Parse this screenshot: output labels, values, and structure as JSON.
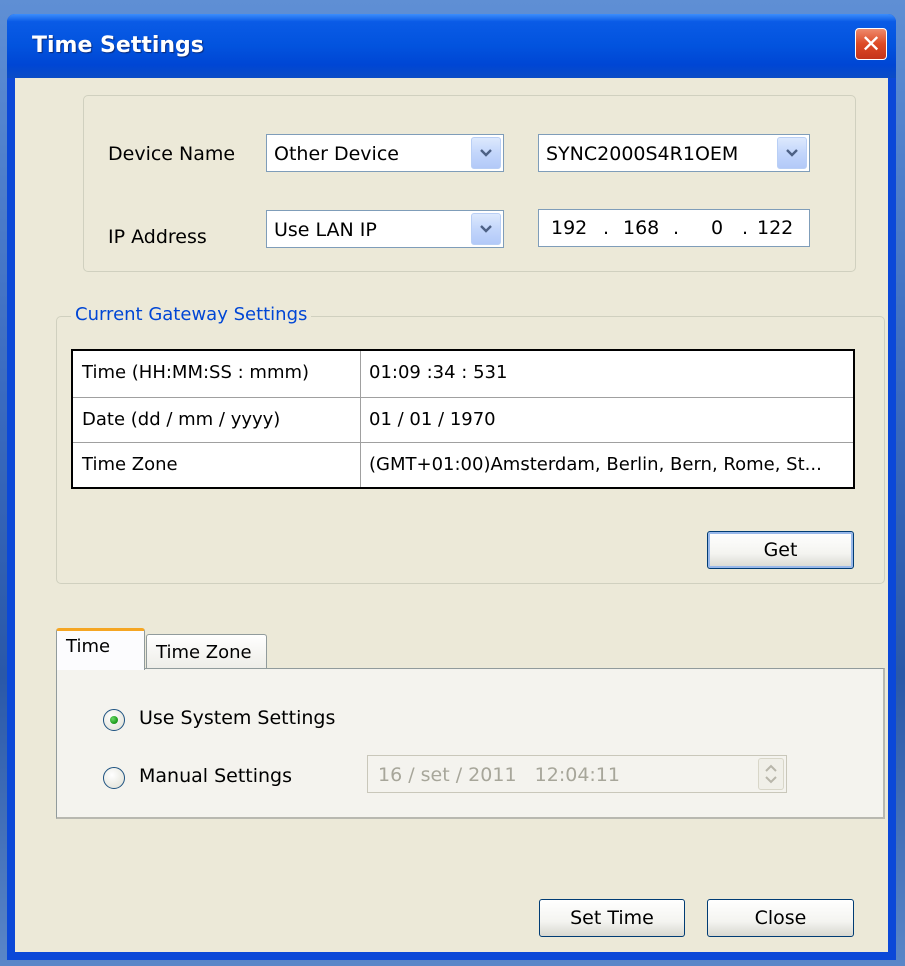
{
  "window": {
    "title": "Time Settings",
    "close_label": "✕"
  },
  "device": {
    "name_label": "Device Name",
    "name_value": "Other Device",
    "model_value": "SYNC2000S4R1OEM",
    "ip_label": "IP Address",
    "ip_mode_value": "Use LAN IP",
    "ip_octets": [
      "192",
      "168",
      "0",
      "122"
    ],
    "ip_separators": [
      ".",
      ".",
      "."
    ]
  },
  "gateway": {
    "legend": "Current Gateway Settings",
    "rows": [
      {
        "label": "Time (HH:MM:SS : mmm)",
        "value": "01:09 :34 : 531"
      },
      {
        "label": "Date (dd / mm / yyyy)",
        "value": "01 / 01 / 1970"
      },
      {
        "label": "Time Zone",
        "value": "(GMT+01:00)Amsterdam, Berlin, Bern, Rome, St..."
      }
    ],
    "get_label": "Get"
  },
  "tabs": [
    {
      "label": "Time",
      "active": true
    },
    {
      "label": "Time Zone",
      "active": false
    }
  ],
  "time_tab": {
    "use_system_label": "Use System Settings",
    "use_system_selected": true,
    "manual_label": "Manual Settings",
    "manual_selected": false,
    "manual_value": "16 / set / 2011   12:04:11"
  },
  "footer": {
    "set_time_label": "Set Time",
    "close_label": "Close"
  },
  "icons": {
    "dropdown": "chevron-down-icon",
    "close": "close-icon",
    "spinner": "spin-updown-icon",
    "radio_selected": "radio-selected-icon",
    "radio_unselected": "radio-unselected-icon"
  },
  "colors": {
    "titlebar": "#0253de",
    "client": "#ece9d8",
    "legend_text": "#0046d5",
    "tab_accent": "#f5a623"
  }
}
